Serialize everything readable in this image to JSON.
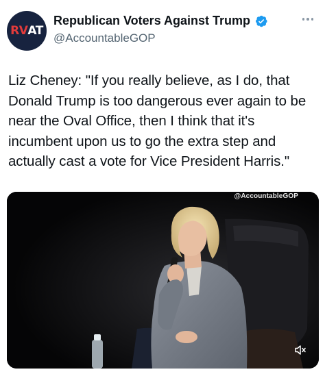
{
  "author": {
    "avatar_text_left": "RV",
    "avatar_text_right": "AT",
    "display_name": "Republican Voters Against Trump",
    "handle": "@AccountableGOP",
    "verified_icon": "verified-badge-icon",
    "colors": {
      "avatar_bg": "#17233f",
      "avatar_red": "#e23b3b",
      "verified_blue": "#1d9bf0"
    }
  },
  "tweet": {
    "text": "Liz Cheney: \"If you really believe, as I do, that Donald Trump is too dangerous ever again to be near the Oval Office, then I think that it's incumbent upon us to go the extra step and actually cast a vote for Vice President Harris.\""
  },
  "media": {
    "watermark": "@AccountableGOP",
    "mute_icon": "speaker-muted-icon",
    "more_icon": "more-options-icon"
  }
}
